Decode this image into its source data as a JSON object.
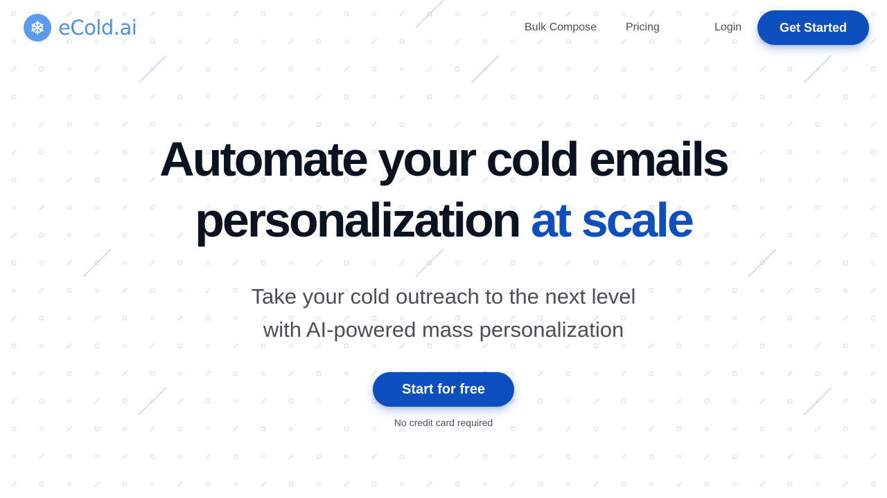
{
  "brand": {
    "name": "eCold.ai",
    "icon": "snowflake-icon",
    "badge_color": "#5a9bf0",
    "text_color": "#4f8fe6"
  },
  "nav": {
    "links": [
      "Bulk Compose",
      "Pricing",
      "Login"
    ],
    "cta_label": "Get Started"
  },
  "hero": {
    "headline_line1": "Automate your cold emails",
    "headline_line2_main": "personalization ",
    "headline_line2_accent": "at scale",
    "subhead_line1": "Take your cold outreach to the next level",
    "subhead_line2": "with AI-powered mass personalization",
    "cta_label": "Start for free",
    "cta_note": "No credit card required"
  },
  "colors": {
    "primary": "#0e4fbf",
    "headline": "#0b1220",
    "body_text": "#4b4f55",
    "pattern": "#c9ddf7"
  }
}
